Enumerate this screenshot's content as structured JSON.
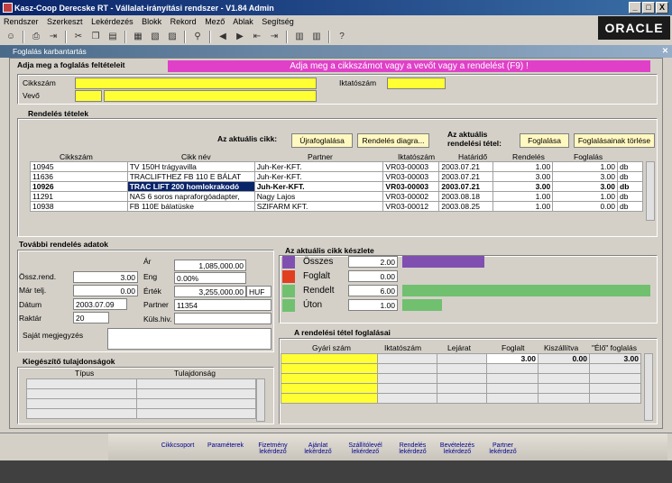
{
  "window": {
    "title": "Kasz-Coop Derecske RT - Vállalat-irányítási rendszer -  V1.84 Admin",
    "min": "_",
    "max": "□",
    "close": "X"
  },
  "menu": [
    "Rendszer",
    "Szerkeszt",
    "Lekérdezés",
    "Blokk",
    "Rekord",
    "Mező",
    "Ablak",
    "Segítség"
  ],
  "brand": "ORACLE",
  "form_title": "Foglalás karbantartás",
  "criteria": {
    "title": "Adja meg a foglalás feltételeit",
    "message": "Adja meg a cikkszámot vagy a vevőt vagy a rendelést (F9) !",
    "cikkszam_label": "Cikkszám",
    "vevo_label": "Vevő",
    "iktato_label": "Iktatószám"
  },
  "orders": {
    "title": "Rendelés tételek",
    "current_item_label": "Az aktuális cikk:",
    "btn_reserve_again": "Újrafoglalása",
    "btn_order_chart": "Rendelés diagra...",
    "current_order_label": "Az aktuális rendelési tétel:",
    "btn_reserve": "Foglalása",
    "btn_delete": "Foglalásainak törlése",
    "headers": [
      "Cikkszám",
      "Cikk név",
      "Partner",
      "Iktatószám",
      "Határidő",
      "Rendelés",
      "Foglalás"
    ],
    "rows": [
      {
        "cikkszam": "10945",
        "nev": "TV 150H trágyavilla",
        "partner": "Juh-Ker-KFT.",
        "iktato": "VR03-00003",
        "hatarido": "2003.07.21",
        "rendeles": "1.00",
        "foglalas": "1.00",
        "unit": "db"
      },
      {
        "cikkszam": "11636",
        "nev": "TRACLIFTHEZ FB 110 E BÁLAT",
        "partner": "Juh-Ker-KFT.",
        "iktato": "VR03-00003",
        "hatarido": "2003.07.21",
        "rendeles": "3.00",
        "foglalas": "3.00",
        "unit": "db"
      },
      {
        "cikkszam": "10926",
        "nev": "TRAC LIFT 200 homlokrakodó",
        "partner": "Juh-Ker-KFT.",
        "iktato": "VR03-00003",
        "hatarido": "2003.07.21",
        "rendeles": "3.00",
        "foglalas": "3.00",
        "unit": "db"
      },
      {
        "cikkszam": "11291",
        "nev": "NAS 6 soros napraforgóadapter,",
        "partner": "Nagy Lajos",
        "iktato": "VR03-00002",
        "hatarido": "2003.08.18",
        "rendeles": "1.00",
        "foglalas": "1.00",
        "unit": "db"
      },
      {
        "cikkszam": "10938",
        "nev": "FB 110E bálatüske",
        "partner": "SZIFARM KFT.",
        "iktato": "VR03-00012",
        "hatarido": "2003.08.25",
        "rendeles": "1.00",
        "foglalas": "0.00",
        "unit": "db"
      }
    ]
  },
  "details": {
    "title": "További rendelés adatok",
    "ar_label": "Ár",
    "ar": "1,085,000.00",
    "eng_label": "Eng",
    "eng": "0.00%",
    "ertek_label": "Érték",
    "ertek": "3,255,000.00",
    "currency": "HUF",
    "partner_label": "Partner",
    "partner": "11354",
    "kulshiv_label": "Küls.hiv.",
    "ossz_label": "Össz.rend.",
    "ossz": "3.00",
    "mar_label": "Már telj.",
    "mar": "0.00",
    "datum_label": "Dátum",
    "datum": "2003.07.09",
    "raktar_label": "Raktár",
    "raktar": "20",
    "note_label": "Saját megjegyzés"
  },
  "stock": {
    "title": "Az aktuális cikk készlete",
    "items": [
      {
        "label": "Összes",
        "value": "2.00",
        "color": "#8050b0",
        "fraction": 0.33
      },
      {
        "label": "Foglalt",
        "value": "0.00",
        "color": "#e04020",
        "fraction": 0
      },
      {
        "label": "Rendelt",
        "value": "6.00",
        "color": "#70c070",
        "fraction": 1
      },
      {
        "label": "Úton",
        "value": "1.00",
        "color": "#70c070",
        "fraction": 0.16
      }
    ]
  },
  "extra": {
    "title": "Kiegészítő tulajdonságok",
    "col_type": "Típus",
    "col_prop": "Tulajdonság"
  },
  "reservations": {
    "title": "A rendelési tétel foglalásai",
    "headers": [
      "Gyári szám",
      "Iktatószám",
      "Lejárat",
      "Foglalt",
      "Kiszállítva",
      "\"Élő\" foglalás"
    ],
    "row": {
      "foglalt": "3.00",
      "kiszallitva": "0.00",
      "elo": "3.00"
    }
  },
  "bottom_links": [
    "Cikkcsoport",
    "Paraméterek",
    "Fizetmény lekérdező",
    "Ajánlat lekérdező",
    "Szállítólevél lekérdező",
    "Rendelés lekérdező",
    "Bevételezés lekérdező",
    "Partner lekérdező"
  ]
}
